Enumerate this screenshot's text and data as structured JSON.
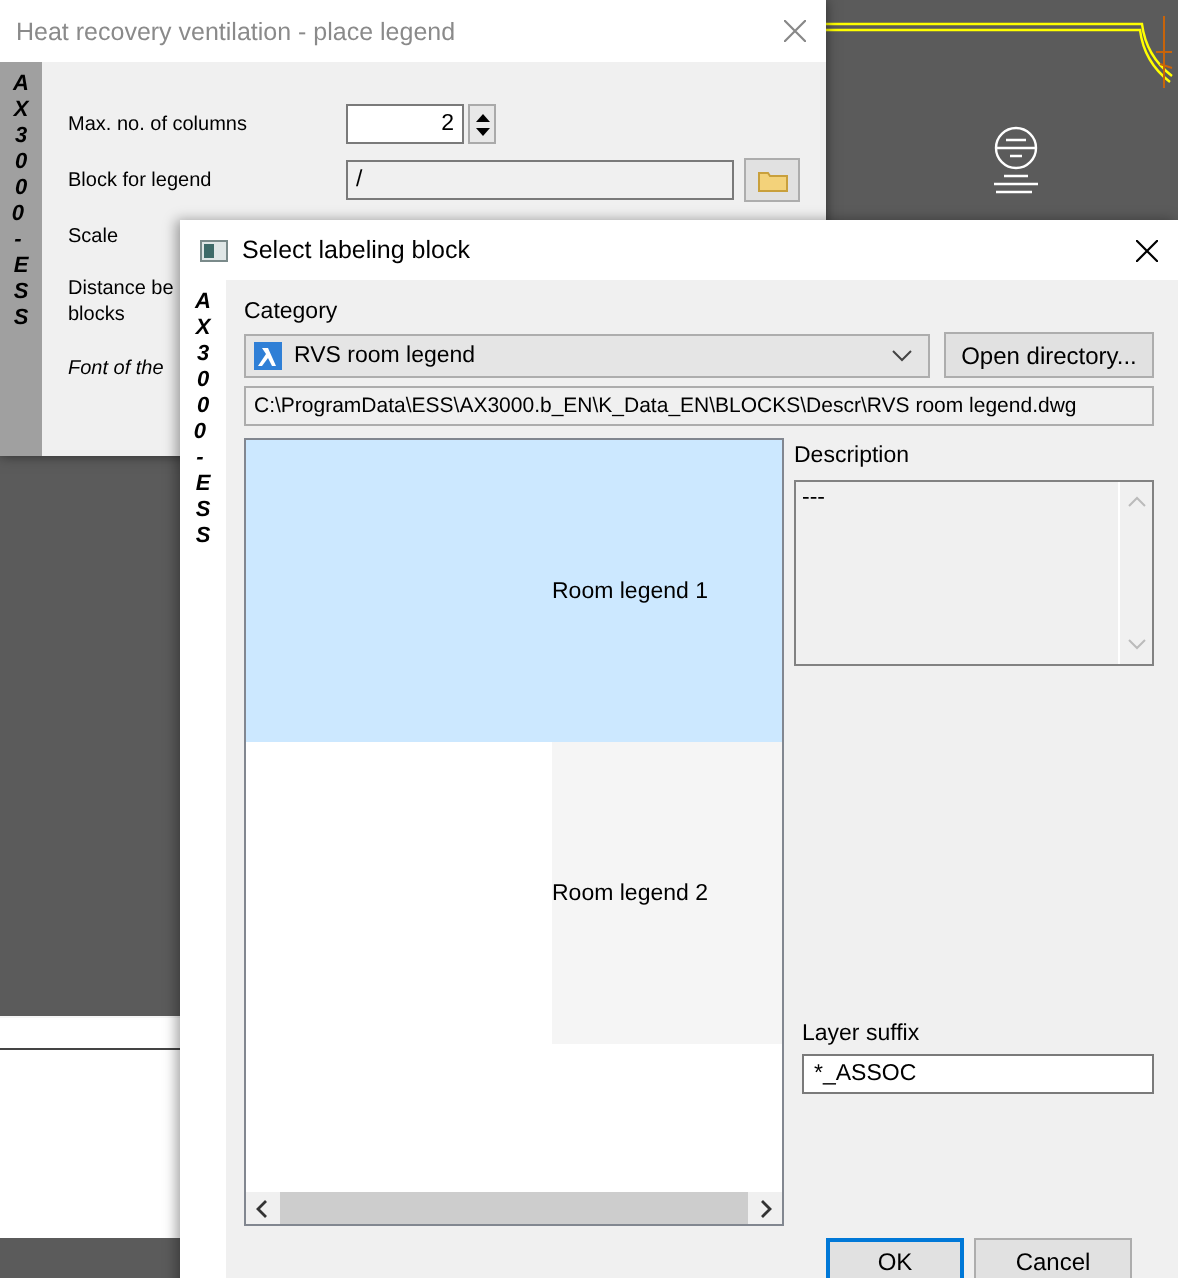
{
  "legend_window": {
    "title": "Heat recovery ventilation - place legend",
    "side_label": "AX3000 - ESS",
    "fields": [
      {
        "kind": "spinner",
        "label": "Max. no. of columns",
        "value": "2"
      },
      {
        "kind": "browse",
        "label": "Block for legend",
        "value": "/"
      },
      {
        "kind": "text",
        "label": "Scale"
      },
      {
        "kind": "label",
        "label": "Distance be\nblocks"
      },
      {
        "kind": "note",
        "label": "Font of the"
      }
    ]
  },
  "dialog": {
    "title": "Select labeling block",
    "side_label": "AX3000 - ESS",
    "category_label": "Category",
    "category": "RVS room legend",
    "open_button": "Open directory...",
    "path": "C:\\ProgramData\\ESS\\AX3000.b_EN\\K_Data_EN\\BLOCKS\\Descr\\RVS room legend.dwg",
    "blocks": [
      {
        "label": "Room legend 1",
        "selected": true
      },
      {
        "label": "Room legend 2",
        "selected": false
      }
    ],
    "description_label": "Description",
    "description": "---",
    "layer_suffix_label": "Layer suffix",
    "layer_suffix": "*_ASSOC",
    "buttons": [
      {
        "label": "OK",
        "default": true
      },
      {
        "label": "Cancel",
        "default": false
      }
    ]
  }
}
